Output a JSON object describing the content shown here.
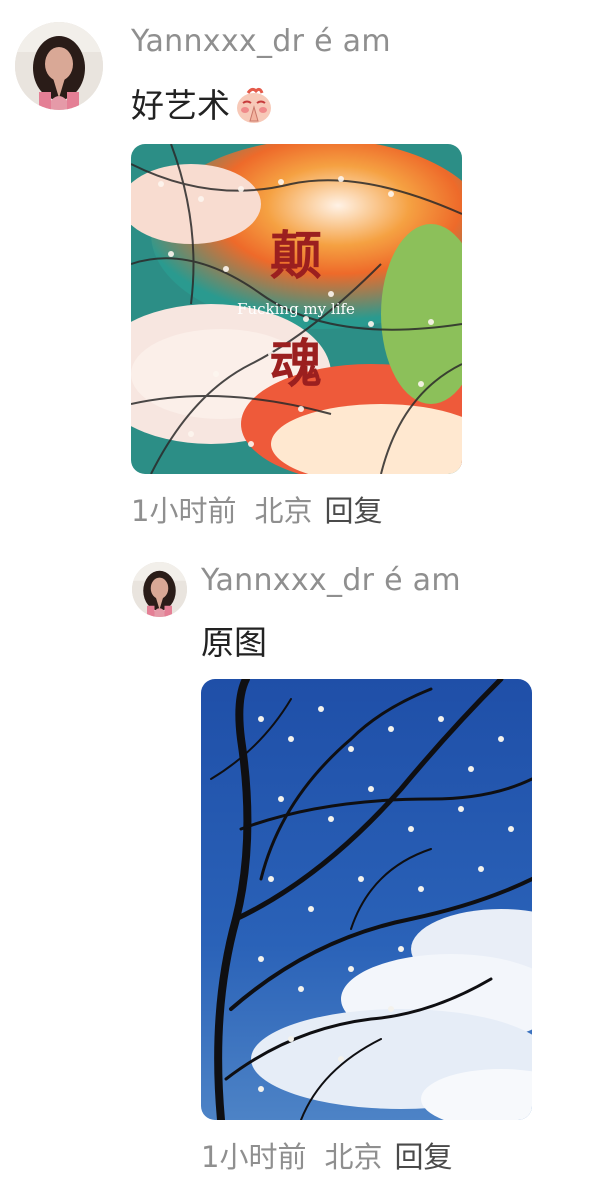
{
  "comments": [
    {
      "username": "Yannxxx_dr é am",
      "text": "好艺术",
      "emoji": "praying-peach-emoji",
      "image": {
        "title_top": "颠",
        "title_bottom": "魂",
        "subtitle": "Fucking my life"
      },
      "time": "1小时前",
      "location": "北京",
      "reply_label": "回复"
    },
    {
      "username": "Yannxxx_dr é am",
      "text": "原图",
      "time": "1小时前",
      "location": "北京",
      "reply_label": "回复"
    }
  ],
  "colors": {
    "username": "#8f8f8f",
    "text": "#222222",
    "meta": "#8f8f8f",
    "reply": "#4a4a4a"
  }
}
